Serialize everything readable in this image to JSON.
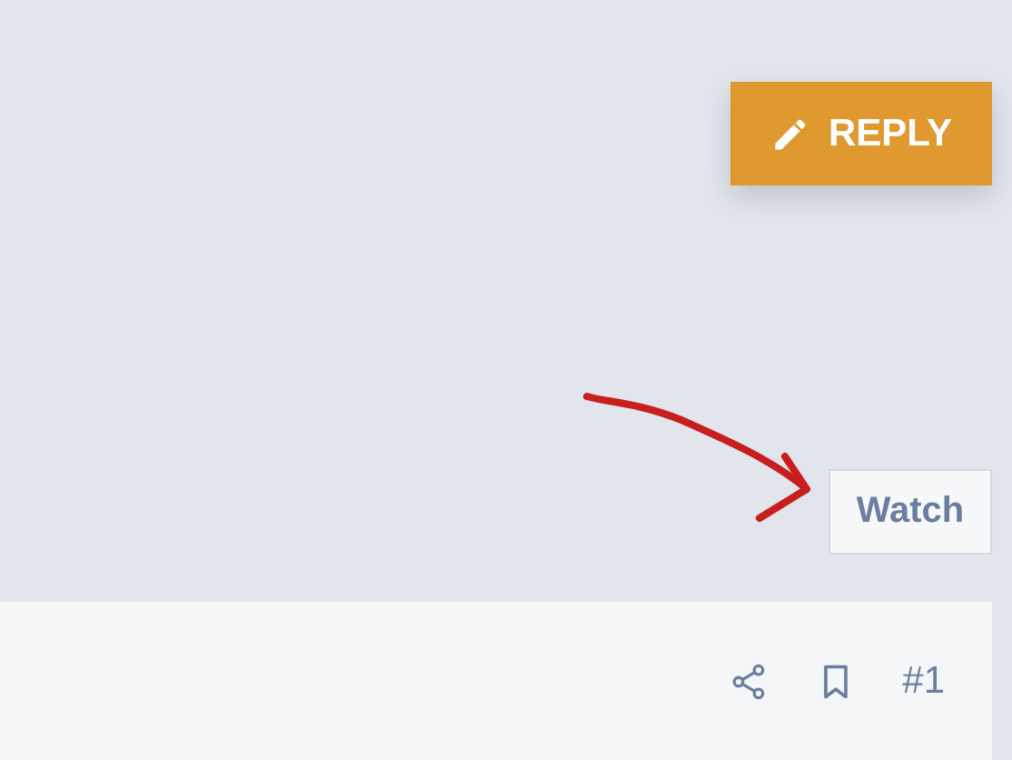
{
  "reply_button": {
    "label": "REPLY"
  },
  "watch_button": {
    "label": "Watch"
  },
  "post_footer": {
    "post_number": "#1"
  }
}
